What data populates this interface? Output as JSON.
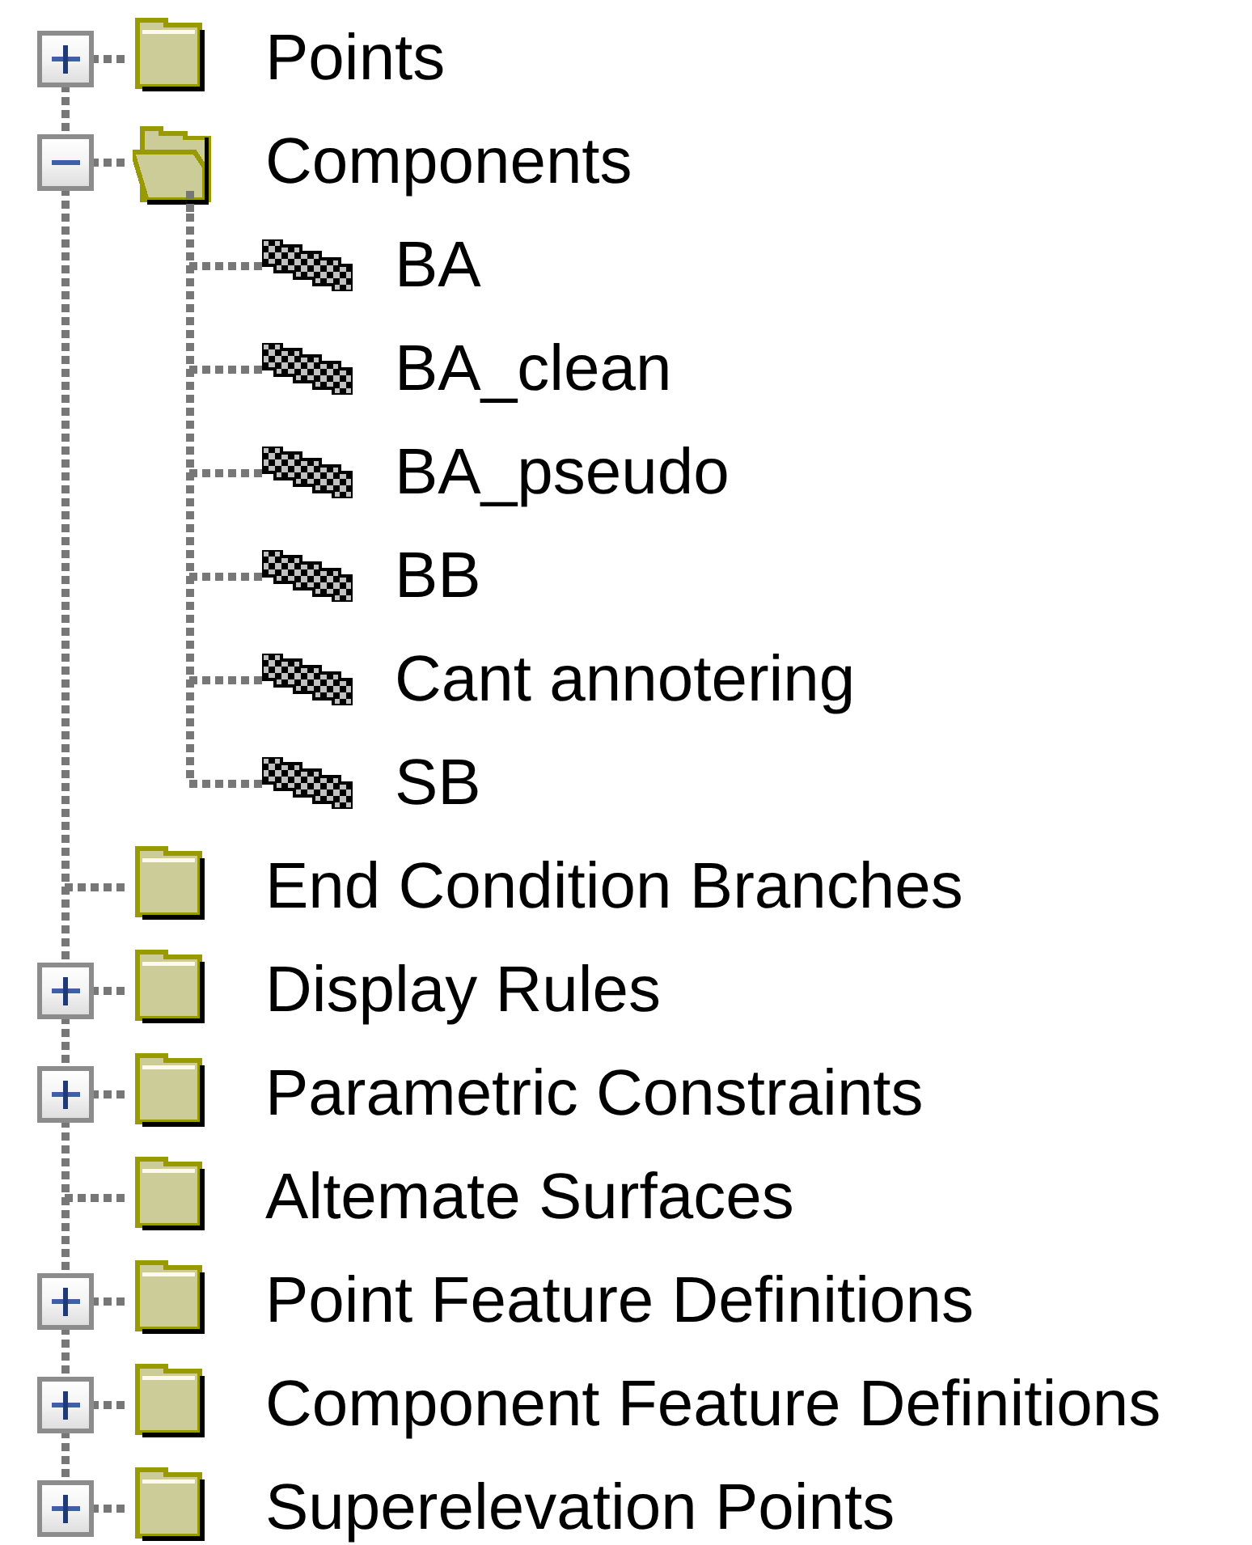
{
  "tree": [
    {
      "label": "Points",
      "kind": "folder",
      "expanded": false
    },
    {
      "label": "Components",
      "kind": "folder",
      "expanded": true,
      "children": [
        {
          "label": "BA",
          "kind": "component"
        },
        {
          "label": "BA_clean",
          "kind": "component"
        },
        {
          "label": "BA_pseudo",
          "kind": "component"
        },
        {
          "label": "BB",
          "kind": "component"
        },
        {
          "label": "Cant annotering",
          "kind": "component"
        },
        {
          "label": "SB",
          "kind": "component"
        }
      ]
    },
    {
      "label": "End Condition Branches",
      "kind": "folder"
    },
    {
      "label": "Display Rules",
      "kind": "folder",
      "expanded": false
    },
    {
      "label": "Parametric Constraints",
      "kind": "folder",
      "expanded": false
    },
    {
      "label": "Altemate Surfaces",
      "kind": "folder"
    },
    {
      "label": "Point Feature Definitions",
      "kind": "folder",
      "expanded": false
    },
    {
      "label": "Component Feature Definitions",
      "kind": "folder",
      "expanded": false
    },
    {
      "label": "Superelevation Points",
      "kind": "folder",
      "expanded": false
    }
  ]
}
